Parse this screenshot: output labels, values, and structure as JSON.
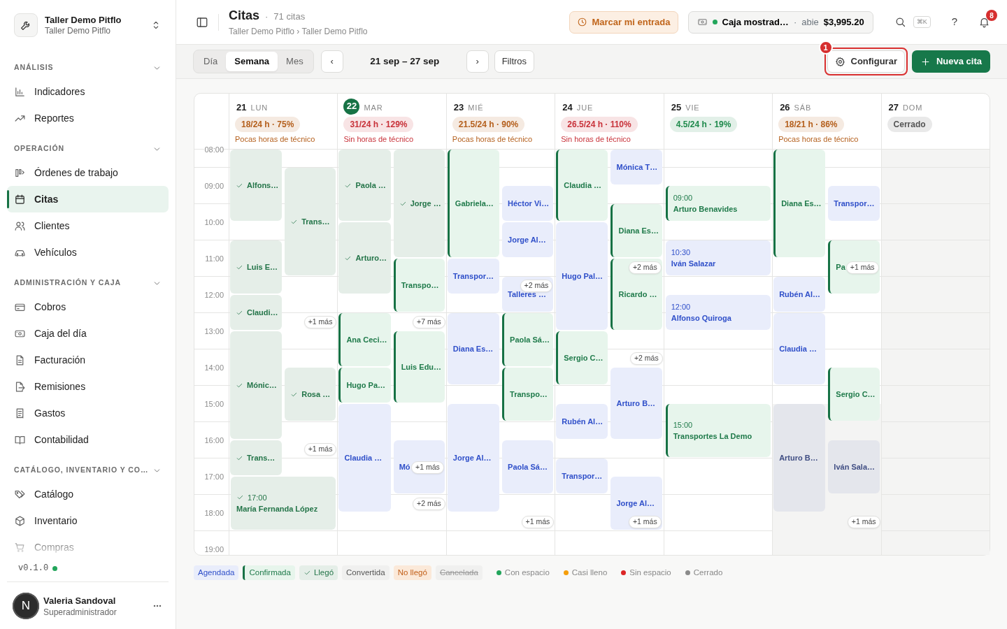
{
  "sidebar": {
    "brand": {
      "name": "Taller Demo Pitflo",
      "subtitle": "Taller Demo Pitflo"
    },
    "sections": [
      {
        "title": "ANÁLISIS",
        "expanded": true,
        "items": [
          {
            "label": "Indicadores",
            "selected": false
          },
          {
            "label": "Reportes",
            "selected": false
          }
        ]
      },
      {
        "title": "OPERACIÓN",
        "expanded": true,
        "items": [
          {
            "label": "Órdenes de trabajo",
            "selected": false
          },
          {
            "label": "Citas",
            "selected": true
          },
          {
            "label": "Clientes",
            "selected": false
          },
          {
            "label": "Vehículos",
            "selected": false
          }
        ]
      },
      {
        "title": "ADMINISTRACIÓN Y CAJA",
        "expanded": true,
        "items": [
          {
            "label": "Cobros",
            "selected": false
          },
          {
            "label": "Caja del día",
            "selected": false
          },
          {
            "label": "Facturación",
            "selected": false
          },
          {
            "label": "Remisiones",
            "selected": false
          },
          {
            "label": "Gastos",
            "selected": false
          },
          {
            "label": "Contabilidad",
            "selected": false
          }
        ]
      },
      {
        "title": "CATÁLOGO, INVENTARIO Y CO…",
        "expanded": true,
        "items": [
          {
            "label": "Catálogo",
            "selected": false
          },
          {
            "label": "Inventario",
            "selected": false
          },
          {
            "label": "Compras",
            "selected": false
          }
        ]
      }
    ],
    "version": "v0.1.0",
    "user": {
      "initial": "N",
      "name": "Valeria Sandoval",
      "role": "Superadministrador"
    }
  },
  "header": {
    "title": "Citas",
    "title_separator": "·",
    "count": "71 citas",
    "breadcrumb": "Taller Demo Pitflo › Taller Demo Pitflo",
    "clock_in": "Marcar mi entrada",
    "register": {
      "name": "Caja mostrad…",
      "separator": "·",
      "state": "abie",
      "amount": "$3,995.20",
      "open": true
    },
    "shortcut": "⌘K",
    "help": "?",
    "notifications": "8"
  },
  "toolbar": {
    "views": [
      {
        "label": "Día",
        "selected": false
      },
      {
        "label": "Semana",
        "selected": true
      },
      {
        "label": "Mes",
        "selected": false
      }
    ],
    "prev": "‹",
    "range": "21 sep – 27 sep",
    "next": "›",
    "filters": "Filtros",
    "configure": {
      "label": "Configurar",
      "highlighted": true,
      "step": "1"
    },
    "new": "Nueva cita"
  },
  "calendar": {
    "hours": [
      "08:00",
      "09:00",
      "10:00",
      "11:00",
      "12:00",
      "13:00",
      "14:00",
      "15:00",
      "16:00",
      "17:00",
      "18:00",
      "19:00"
    ],
    "days": [
      {
        "number": "21",
        "weekday": "LUN",
        "today": false,
        "closed": false,
        "capacity": {
          "label": "18/24 h · 75%",
          "color": "#b45f1c"
        },
        "note": "Pocas horas de técnico",
        "events": [
          {
            "name": "Alfons…",
            "kind": "llego"
          },
          {
            "name": "Trans…",
            "kind": "llego"
          },
          {
            "name": "Luis E…",
            "kind": "llego"
          },
          {
            "name": "Claudi…",
            "kind": "llego"
          },
          {
            "name": "Mónic…",
            "kind": "llego"
          },
          {
            "name": "Rosa …",
            "kind": "llego"
          },
          {
            "name": "Trans…",
            "kind": "llego"
          },
          {
            "name": "María Fernanda López",
            "time": "17:00",
            "kind": "llego"
          }
        ],
        "more": [
          {
            "label": "+1 más"
          },
          {
            "label": "+1 más"
          }
        ]
      },
      {
        "number": "22",
        "weekday": "MAR",
        "today": true,
        "closed": false,
        "capacity": {
          "label": "31/24 h · 129%",
          "color": "#c8323a"
        },
        "note": "Sin horas de técnico",
        "events": [
          {
            "name": "Paola …",
            "kind": "llego"
          },
          {
            "name": "Jorge …",
            "kind": "llego"
          },
          {
            "name": "Arturo…",
            "kind": "llego"
          },
          {
            "name": "Transpo…",
            "kind": "confirmada"
          },
          {
            "name": "Ana Ceci…",
            "kind": "confirmada"
          },
          {
            "name": "Luis Edu…",
            "kind": "confirmada"
          },
          {
            "name": "Hugo Pa…",
            "kind": "confirmada"
          },
          {
            "name": "Claudia …",
            "kind": "agendada"
          },
          {
            "name": "Mó",
            "kind": "agendada"
          }
        ],
        "more": [
          {
            "label": "+7 más"
          },
          {
            "label": "+1 más"
          },
          {
            "label": "+2 más"
          }
        ]
      },
      {
        "number": "23",
        "weekday": "MIÉ",
        "today": false,
        "closed": false,
        "capacity": {
          "label": "21.5/24 h · 90%",
          "color": "#b45f1c"
        },
        "note": "Pocas horas de técnico",
        "events": [
          {
            "name": "Gabriela…",
            "kind": "confirmada"
          },
          {
            "name": "Héctor Vi…",
            "kind": "agendada"
          },
          {
            "name": "Jorge Al…",
            "kind": "agendada"
          },
          {
            "name": "Transpor…",
            "kind": "agendada"
          },
          {
            "name": "Talleres …",
            "kind": "agendada"
          },
          {
            "name": "Paola Sá…",
            "kind": "confirmada"
          },
          {
            "name": "Diana Es…",
            "kind": "agendada"
          },
          {
            "name": "Transpo…",
            "kind": "confirmada"
          },
          {
            "name": "Jorge Al…",
            "kind": "agendada"
          },
          {
            "name": "Paola Sá…",
            "kind": "agendada"
          }
        ],
        "more": [
          {
            "label": "+2 más"
          },
          {
            "label": "+1 más"
          }
        ]
      },
      {
        "number": "24",
        "weekday": "JUE",
        "today": false,
        "closed": false,
        "capacity": {
          "label": "26.5/24 h · 110%",
          "color": "#c8323a"
        },
        "note": "Sin horas de técnico",
        "events": [
          {
            "name": "Claudia …",
            "kind": "confirmada"
          },
          {
            "name": "Mónica T…",
            "kind": "agendada"
          },
          {
            "name": "Diana Es…",
            "kind": "confirmada"
          },
          {
            "name": "Hugo Pal…",
            "kind": "agendada"
          },
          {
            "name": "Ricardo …",
            "kind": "confirmada"
          },
          {
            "name": "Sergio C…",
            "kind": "confirmada"
          },
          {
            "name": "Arturo B…",
            "kind": "agendada"
          },
          {
            "name": "Rubén Al…",
            "kind": "agendada"
          },
          {
            "name": "Transpor…",
            "kind": "agendada"
          },
          {
            "name": "Jorge Al…",
            "kind": "agendada"
          }
        ],
        "more": [
          {
            "label": "+2 más"
          },
          {
            "label": "+2 más"
          },
          {
            "label": "+1 más"
          }
        ]
      },
      {
        "number": "25",
        "weekday": "VIE",
        "today": false,
        "closed": false,
        "capacity": {
          "label": "4.5/24 h · 19%",
          "color": "#1f8a4c"
        },
        "events": [
          {
            "name": "Arturo Benavides",
            "time": "09:00",
            "kind": "confirmada"
          },
          {
            "name": "Iván Salazar",
            "time": "10:30",
            "kind": "agendada"
          },
          {
            "name": "Alfonso Quiroga",
            "time": "12:00",
            "kind": "agendada"
          },
          {
            "name": "Transportes La Demo",
            "time": "15:00",
            "kind": "confirmada"
          }
        ]
      },
      {
        "number": "26",
        "weekday": "SÁB",
        "today": false,
        "closed": false,
        "closed_hours": {
          "level": 0.372
        },
        "capacity": {
          "label": "18/21 h · 86%",
          "color": "#b45f1c"
        },
        "note": "Pocas horas de técnico",
        "events": [
          {
            "name": "Diana Es…",
            "kind": "confirmada"
          },
          {
            "name": "Transpor…",
            "kind": "agendada"
          },
          {
            "name": "Pa",
            "kind": "confirmada"
          },
          {
            "name": "Rubén Al…",
            "kind": "agendada"
          },
          {
            "name": "Claudia …",
            "kind": "agendada"
          },
          {
            "name": "Sergio C…",
            "kind": "confirmada"
          },
          {
            "name": "Arturo B…",
            "kind": "agendada"
          },
          {
            "name": "Iván Sala…",
            "kind": "agendada"
          }
        ],
        "more": [
          {
            "label": "+1 más"
          },
          {
            "label": "+1 más"
          }
        ]
      },
      {
        "number": "27",
        "weekday": "DOM",
        "today": false,
        "closed": true,
        "capacity": {
          "label": "Cerrado",
          "color": "#555555"
        }
      }
    ]
  },
  "legend": {
    "statuses": [
      {
        "label": "Agendada",
        "kind": "agendada"
      },
      {
        "label": "Confirmada",
        "kind": "confirmada"
      },
      {
        "label": "Llegó",
        "kind": "llego"
      },
      {
        "label": "Convertida",
        "kind": "convertida"
      },
      {
        "label": "No llegó",
        "kind": "no_llego"
      },
      {
        "label": "Cancelada",
        "kind": "cancelada"
      }
    ],
    "capacity": [
      {
        "label": "Con espacio",
        "color": "#22a55b"
      },
      {
        "label": "Casi lleno",
        "color": "#f59e0b"
      },
      {
        "label": "Sin espacio",
        "color": "#dc2626"
      },
      {
        "label": "Cerrado",
        "color": "#8a8a8a"
      }
    ]
  }
}
